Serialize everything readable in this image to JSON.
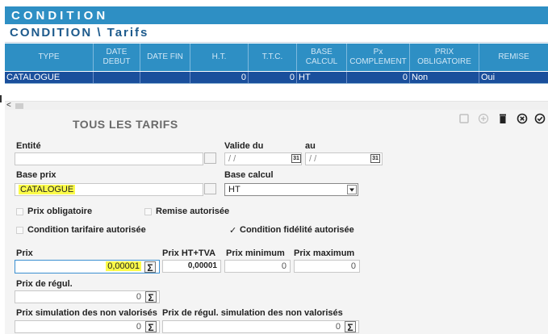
{
  "title": "CONDITION",
  "breadcrumb": "CONDITION \\ Tarifs",
  "table": {
    "headers": [
      "TYPE",
      "DATE DEBUT",
      "DATE FIN",
      "H.T.",
      "T.T.C.",
      "BASE CALCUL",
      "Px COMPLEMENT",
      "PRIX OBLIGATOIRE",
      "REMISE"
    ],
    "row": [
      "CATALOGUE",
      "",
      "",
      "0",
      "0",
      "HT",
      "0",
      "Non",
      "Oui"
    ]
  },
  "scroll_arrow": "<",
  "panel": {
    "title": "TOUS LES TARIFS",
    "icons": [
      "copy-icon",
      "add-icon",
      "trash-icon",
      "cancel-icon",
      "validate-icon"
    ],
    "labels": {
      "entite": "Entité",
      "valide_du": "Valide du",
      "au": "au",
      "base_prix": "Base prix",
      "base_calcul": "Base calcul",
      "prix": "Prix",
      "prix_ht_tva": "Prix HT+TVA",
      "prix_min": "Prix minimum",
      "prix_max": "Prix maximum",
      "prix_regul": "Prix de régul.",
      "prix_sim": "Prix simulation des non valorisés",
      "prix_regul_sim": "Prix de régul. simulation des non valorisés"
    },
    "values": {
      "entite": "",
      "valide_du": "/ /",
      "au": "/ /",
      "base_prix": "CATALOGUE",
      "base_calcul": "HT",
      "prix": "0,00001",
      "prix_ht_tva": "0,00001",
      "prix_min": "0",
      "prix_max": "0",
      "prix_regul": "0",
      "prix_sim": "0",
      "prix_regul_sim": "0"
    },
    "checkboxes": {
      "prix_obligatoire": {
        "label": "Prix obligatoire",
        "checked": false
      },
      "remise_autorisee": {
        "label": "Remise autorisée",
        "checked": false
      },
      "condition_tarifaire": {
        "label": "Condition tarifaire autorisée",
        "checked": false
      },
      "condition_fidelite": {
        "label": "Condition fidélité autorisée",
        "checked": true
      }
    },
    "sigma": "Σ",
    "cal_label": "31",
    "checkmark": "✓"
  },
  "colors": {
    "accent": "#2e8fc4",
    "selected_row": "#1a4f9c",
    "highlight": "#fbfb49"
  }
}
